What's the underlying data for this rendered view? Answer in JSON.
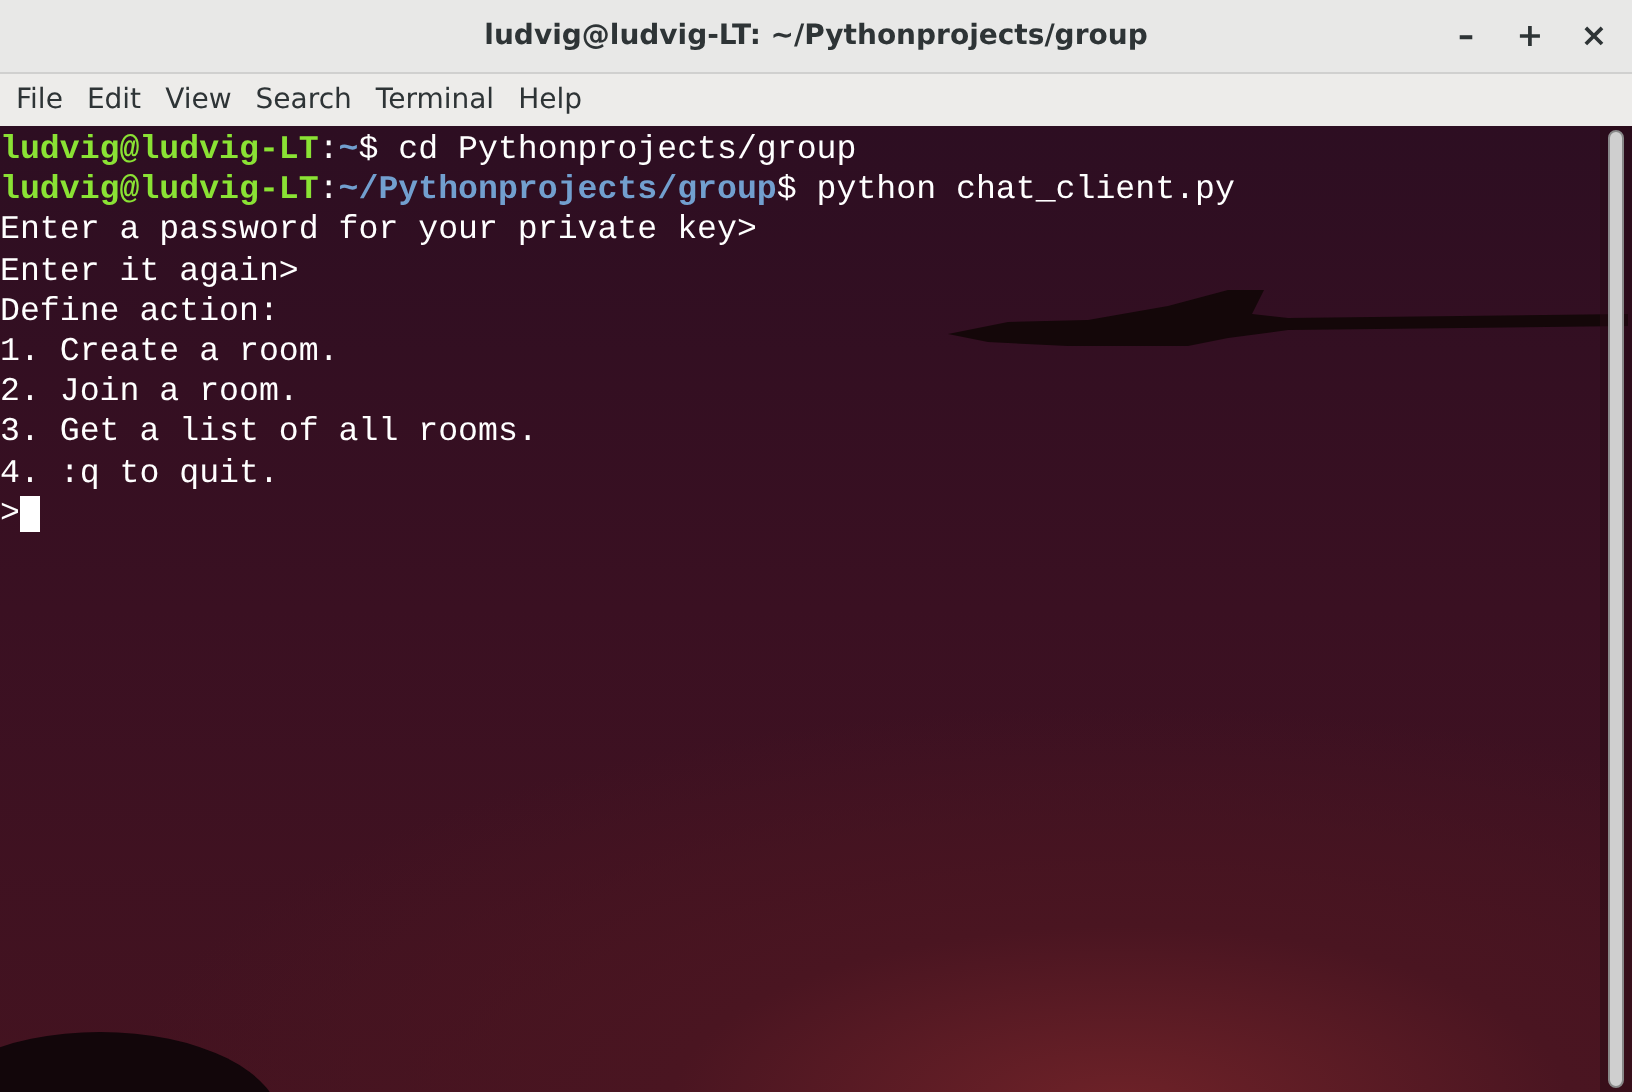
{
  "window": {
    "title": "ludvig@ludvig-LT: ~/Pythonprojects/group",
    "controls": [
      "–",
      "+",
      "×"
    ]
  },
  "menu": [
    "File",
    "Edit",
    "View",
    "Search",
    "Terminal",
    "Help"
  ],
  "terminal": {
    "lines": [
      {
        "kind": "prompt",
        "user_host": "ludvig@ludvig-LT",
        "sep": ":",
        "path": "~",
        "command": "$ cd Pythonprojects/group"
      },
      {
        "kind": "prompt",
        "user_host": "ludvig@ludvig-LT",
        "sep": ":",
        "path": "~/Pythonprojects/group",
        "command": "$ python chat_client.py"
      },
      {
        "kind": "output",
        "text": "Enter a password for your private key>"
      },
      {
        "kind": "output",
        "text": "Enter it again>"
      },
      {
        "kind": "output",
        "text": "Define action:"
      },
      {
        "kind": "output",
        "text": "1. Create a room."
      },
      {
        "kind": "output",
        "text": "2. Join a room."
      },
      {
        "kind": "output",
        "text": "3. Get a list of all rooms."
      },
      {
        "kind": "output",
        "text": "4. :q to quit."
      },
      {
        "kind": "input",
        "text": ">",
        "cursor": true
      }
    ]
  }
}
